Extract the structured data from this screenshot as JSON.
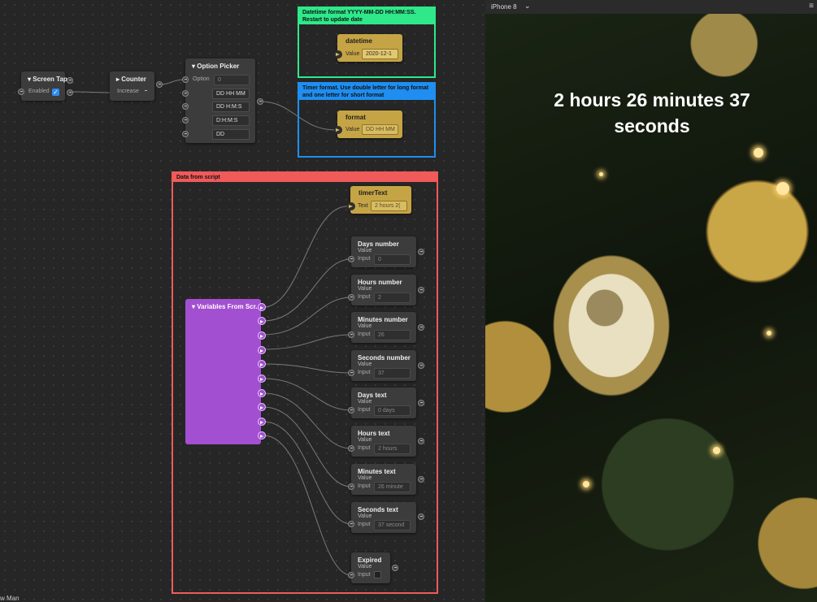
{
  "editor": {
    "bottom_label": "w Man",
    "screen_tap": {
      "title": "Screen Tap",
      "enabled_label": "Enabled",
      "enabled_checked": true
    },
    "counter": {
      "title": "Counter",
      "increase_label": "Increase"
    },
    "option_picker": {
      "title": "Option Picker",
      "option_label": "Option",
      "option_value": "0",
      "options": [
        "DD HH MM",
        "DD H:M:S",
        "D:H:M:S",
        "DD"
      ]
    },
    "groups": {
      "datetime_group": "Datetime format YYYY-MM-DD HH:MM:SS. Restart to update date",
      "timer_group": "Timer format. Use double letter for long format and one letter for short format",
      "script_group": "Data from script"
    },
    "datetime_node": {
      "title": "datetime",
      "label": "Value",
      "value": "2020-12-1"
    },
    "format_node": {
      "title": "format",
      "label": "Value",
      "value": "DD HH MM"
    },
    "timer_text_node": {
      "title": "timerText",
      "label": "Text",
      "value": "2 hours 2("
    },
    "variables_node": {
      "title": "Variables From Scr..."
    },
    "value_nodes": [
      {
        "title": "Days number",
        "sub": "Value",
        "input_label": "Input",
        "value": "0"
      },
      {
        "title": "Hours number",
        "sub": "Value",
        "input_label": "Input",
        "value": "2"
      },
      {
        "title": "Minutes number",
        "sub": "Value",
        "input_label": "Input",
        "value": "26"
      },
      {
        "title": "Seconds number",
        "sub": "Value",
        "input_label": "Input",
        "value": "37"
      },
      {
        "title": "Days text",
        "sub": "Value",
        "input_label": "Input",
        "value": "0 days"
      },
      {
        "title": "Hours text",
        "sub": "Value",
        "input_label": "Input",
        "value": "2 hours"
      },
      {
        "title": "Minutes text",
        "sub": "Value",
        "input_label": "Input",
        "value": "26 minute"
      },
      {
        "title": "Seconds text",
        "sub": "Value",
        "input_label": "Input",
        "value": "37 second"
      }
    ],
    "expired_node": {
      "title": "Expired",
      "sub": "Value",
      "input_label": "Input"
    }
  },
  "preview": {
    "device_name": "iPhone 8",
    "chevron_icon": "chevron-down-icon",
    "menu_icon": "menu-icon",
    "timer_text": "2 hours 26 minutes 37 seconds"
  },
  "colors": {
    "datetime_group": "#2ee88a",
    "timer_group": "#1f8ef0",
    "script_group": "#f05a5a",
    "yellow_node": "#c5a445",
    "purple_node": "#a34fd1"
  }
}
